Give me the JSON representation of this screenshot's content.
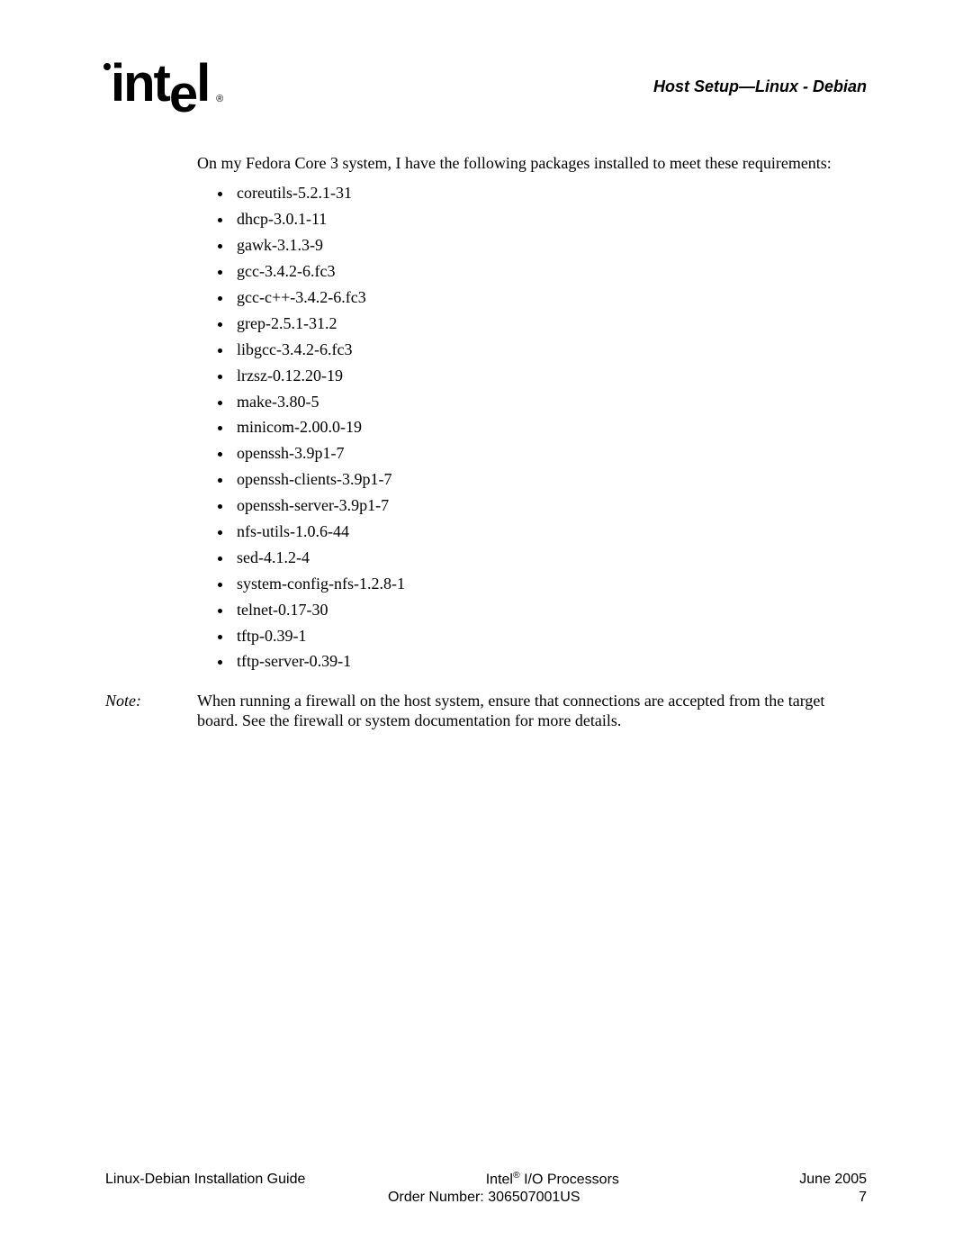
{
  "header": {
    "title": "Host Setup—Linux - Debian"
  },
  "body": {
    "intro": "On my Fedora Core 3 system, I have the following packages installed to meet these requirements:",
    "packages": [
      "coreutils-5.2.1-31",
      "dhcp-3.0.1-11",
      "gawk-3.1.3-9",
      "gcc-3.4.2-6.fc3",
      "gcc-c++-3.4.2-6.fc3",
      "grep-2.5.1-31.2",
      "libgcc-3.4.2-6.fc3",
      "lrzsz-0.12.20-19",
      "make-3.80-5",
      "minicom-2.00.0-19",
      "openssh-3.9p1-7",
      "openssh-clients-3.9p1-7",
      "openssh-server-3.9p1-7",
      "nfs-utils-1.0.6-44",
      "sed-4.1.2-4",
      "system-config-nfs-1.2.8-1",
      "telnet-0.17-30",
      "tftp-0.39-1",
      "tftp-server-0.39-1"
    ],
    "note_label": "Note:",
    "note_text": "When running a firewall on the host system, ensure that connections are accepted from the target board. See the firewall or system documentation for more details."
  },
  "footer": {
    "left": "Linux-Debian Installation Guide",
    "center_line1_pre": "Intel",
    "center_line1_post": " I/O Processors",
    "center_line2": "Order Number: 306507001US",
    "right_line1": "June 2005",
    "right_line2": "7"
  }
}
